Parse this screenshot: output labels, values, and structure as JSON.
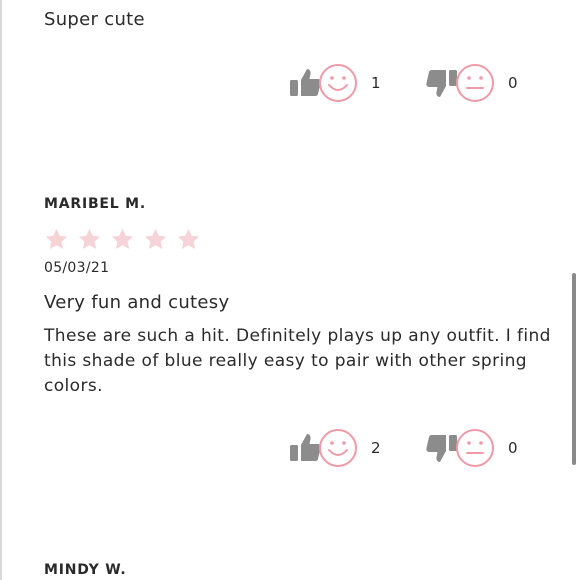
{
  "colors": {
    "accent_pink": "#ef9aa8",
    "star_empty": "#f6d3d7",
    "icon_grey": "#8c8c8c",
    "text": "#2a2a2a"
  },
  "reviews": [
    {
      "title": "Super cute",
      "helpful_count": "1",
      "unhelpful_count": "0"
    },
    {
      "reviewer": "MARIBEL M.",
      "rating": 0,
      "rating_max": 5,
      "date": "05/03/21",
      "title": "Very fun and cutesy",
      "body": "These are such a hit. Definitely plays up any outfit. I find this shade of blue really easy to pair with other spring colors.",
      "helpful_count": "2",
      "unhelpful_count": "0"
    },
    {
      "reviewer": "MINDY W."
    }
  ],
  "icons": {
    "helpful": "thumbs-up-icon",
    "helpful_face": "smile-face-icon",
    "unhelpful": "thumbs-down-icon",
    "unhelpful_face": "neutral-face-icon",
    "star": "star-icon"
  }
}
